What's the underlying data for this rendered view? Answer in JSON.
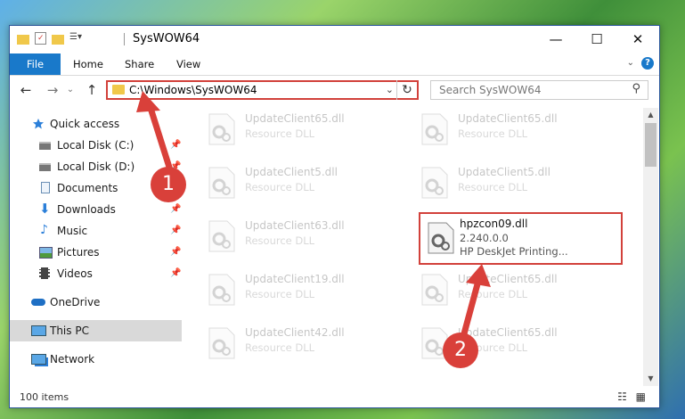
{
  "window": {
    "title": "SysWOW64",
    "controls": {
      "minimize": "—",
      "maximize": "☐",
      "close": "✕"
    }
  },
  "ribbon": {
    "tabs": [
      "File",
      "Home",
      "Share",
      "View"
    ],
    "help": "?",
    "collapse": "⌄"
  },
  "navigation": {
    "back": "←",
    "forward": "→",
    "recent": "⌄",
    "up": "↑",
    "address": "C:\\Windows\\SysWOW64",
    "address_dropdown": "⌄",
    "refresh": "↻",
    "search_placeholder": "Search SysWOW64",
    "search_icon": "⚲"
  },
  "sidebar": {
    "items": [
      {
        "label": "Quick access",
        "icon": "star-icon",
        "pinned": false,
        "selected": false
      },
      {
        "label": "Local Disk (C:)",
        "icon": "drive-icon",
        "pinned": true,
        "selected": false
      },
      {
        "label": "Local Disk (D:)",
        "icon": "drive-icon",
        "pinned": true,
        "selected": false
      },
      {
        "label": "Documents",
        "icon": "documents-icon",
        "pinned": true,
        "selected": false
      },
      {
        "label": "Downloads",
        "icon": "download-icon",
        "pinned": true,
        "selected": false
      },
      {
        "label": "Music",
        "icon": "music-icon",
        "pinned": true,
        "selected": false
      },
      {
        "label": "Pictures",
        "icon": "pictures-icon",
        "pinned": true,
        "selected": false
      },
      {
        "label": "Videos",
        "icon": "videos-icon",
        "pinned": true,
        "selected": false
      },
      {
        "label": "OneDrive",
        "icon": "cloud-icon",
        "pinned": false,
        "selected": false
      },
      {
        "label": "This PC",
        "icon": "computer-icon",
        "pinned": false,
        "selected": true
      },
      {
        "label": "Network",
        "icon": "network-icon",
        "pinned": false,
        "selected": false
      }
    ],
    "pin_glyph": "📌"
  },
  "files": {
    "left": [
      {
        "name": "UpdateClient65.dll",
        "desc": "Resource DLL"
      },
      {
        "name": "UpdateClient5.dll",
        "desc": "Resource DLL"
      },
      {
        "name": "UpdateClient63.dll",
        "desc": "Resource DLL"
      },
      {
        "name": "UpdateClient19.dll",
        "desc": "Resource DLL"
      },
      {
        "name": "UpdateClient42.dll",
        "desc": "Resource DLL"
      }
    ],
    "right": [
      {
        "name": "UpdateClient65.dll",
        "desc": "Resource DLL"
      },
      {
        "name": "UpdateClient5.dll",
        "desc": "Resource DLL"
      },
      {
        "name": "UpdateClient65.dll",
        "desc": "Resource DLL"
      },
      {
        "name": "UpdateClient65.dll",
        "desc": "Resource DLL"
      }
    ],
    "highlighted": {
      "name": "hpzcon09.dll",
      "version": "2.240.0.0",
      "desc": "HP DeskJet Printing..."
    }
  },
  "status": {
    "count": "100 items",
    "views": "☷ ▦"
  },
  "annotations": {
    "badge1": "1",
    "badge2": "2",
    "color": "#d9403a"
  }
}
